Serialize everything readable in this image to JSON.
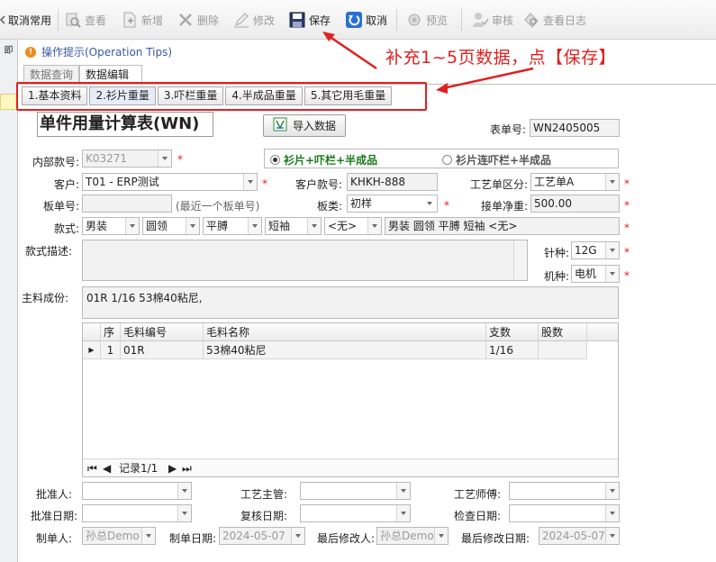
{
  "toolbar": {
    "buttons": [
      {
        "label": "取消常用"
      },
      {
        "label": "查看"
      },
      {
        "label": "新增"
      },
      {
        "label": "删除"
      },
      {
        "label": "修改"
      },
      {
        "label": "保存"
      },
      {
        "label": "取消"
      },
      {
        "label": "预览"
      },
      {
        "label": "审核"
      },
      {
        "label": "查看日志"
      }
    ]
  },
  "left_strip": {
    "top_label": "即"
  },
  "tips": {
    "text": "操作提示(Operation Tips)"
  },
  "annotation": {
    "text": "补充1~5页数据，点【保存】",
    "color": "#e02020"
  },
  "outer_tabs": [
    "数据查询",
    "数据编辑"
  ],
  "inner_tabs": [
    "1.基本资料",
    "2.衫片重量",
    "3.吓栏重量",
    "4.半成品重量",
    "5.其它用毛重量"
  ],
  "form": {
    "title": "单件用量计算表(WN)",
    "import_button": "导入数据",
    "order_no_label": "表单号:",
    "order_no": "WN2405005",
    "internal_no_label": "内部款号:",
    "internal_no": "K03271",
    "radio_1": "衫片+吓栏+半成品",
    "radio_2": "衫片连吓栏+半成品",
    "customer_label": "客户:",
    "customer": "T01 - ERP测试",
    "cust_style_label": "客户款号:",
    "cust_style": "KHKH-888",
    "craft_label": "工艺单区分:",
    "craft": "工艺单A",
    "board_no_label": "板单号:",
    "board_no_hint": "(最近一个板单号)",
    "board_type_label": "板类:",
    "board_type": "初样",
    "net_weight_label": "接单净重:",
    "net_weight": "500.00",
    "style_label": "款式:",
    "style_parts": [
      "男装",
      "圆领",
      "平膊",
      "短袖",
      "<无>"
    ],
    "style_summary": "男装  圆领  平膊  短袖 <无>",
    "desc_label": "款式描述:",
    "needle_label": "针种:",
    "needle": "12G",
    "machine_label": "机种:",
    "machine": "电机",
    "material_label": "主料成份:",
    "material": "01R 1/16 53棉40粘尼,",
    "grid_headers": [
      "序",
      "毛料编号",
      "毛料名称",
      "支数",
      "股数"
    ],
    "grid_rows": [
      {
        "seq": "1",
        "code": "01R",
        "name": "53棉40粘尼",
        "count": "1/16",
        "ply": ""
      }
    ],
    "record_nav": "记录1/1",
    "approver_label": "批准人:",
    "craft_supervisor_label": "工艺主管:",
    "craft_master_label": "工艺师傅:",
    "approve_date_label": "批准日期:",
    "review_date_label": "复核日期:",
    "check_date_label": "检查日期:",
    "maker_label": "制单人:",
    "maker": "孙总Demo",
    "make_date_label": "制单日期:",
    "make_date": "2024-05-07",
    "last_modifier_label": "最后修改人:",
    "last_modifier": "孙总Demo",
    "last_modify_date_label": "最后修改日期:",
    "last_modify_date": "2024-05-07"
  },
  "colors": {
    "accent_red": "#e02020",
    "radio_green": "#1a7a1a",
    "link_blue": "#3a58a8"
  },
  "icons": [
    "back-icon",
    "view-icon",
    "new-icon",
    "delete-icon",
    "edit-icon",
    "save-icon",
    "cancel-icon",
    "preview-icon",
    "approve-icon",
    "log-icon",
    "info-icon",
    "import-icon"
  ]
}
